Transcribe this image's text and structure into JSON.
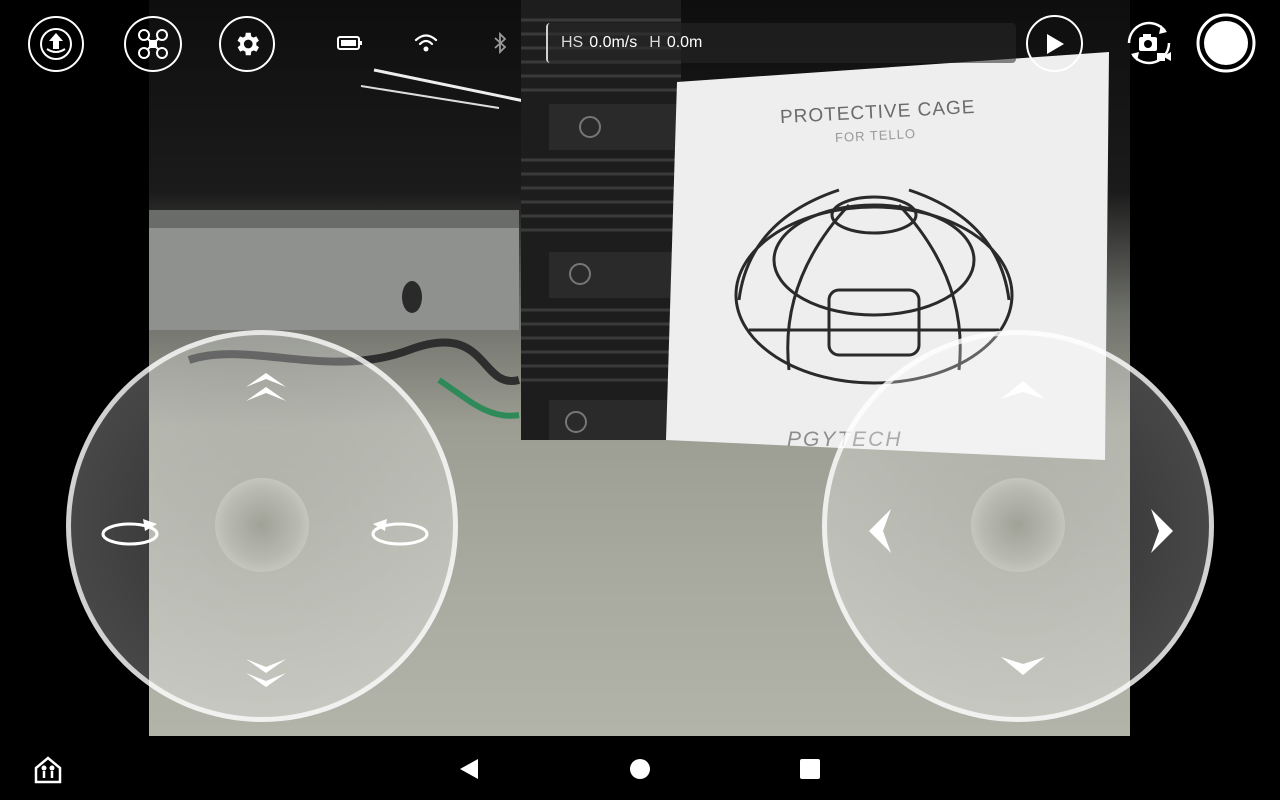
{
  "top_bar": {
    "takeoff_icon": "takeoff-icon",
    "drone_icon": "drone-icon",
    "settings_icon": "gear-icon",
    "status_icons": [
      "battery-icon",
      "wifi-icon",
      "bluetooth-icon"
    ],
    "hs_label": "HS",
    "hs_value": "0.0m/s",
    "h_label": "H",
    "h_value": "0.0m",
    "play_icon": "play-icon",
    "camera_switch_icon": "camera-switch-icon",
    "shutter_icon": "shutter-icon"
  },
  "camera_feed": {
    "sign_title": "PROTECTIVE CAGE",
    "sign_subtitle": "FOR TELLO",
    "sign_brand": "PGYTECH"
  },
  "left_joystick": {
    "up_icon": "double-chevron-up-icon",
    "down_icon": "double-chevron-down-icon",
    "rotate_left_icon": "rotate-ccw-icon",
    "rotate_right_icon": "rotate-cw-icon"
  },
  "right_joystick": {
    "up_icon": "chevron-up-icon",
    "down_icon": "chevron-down-icon",
    "left_icon": "chevron-left-icon",
    "right_icon": "chevron-right-icon"
  },
  "nav_bar": {
    "app_icon": "accessibility-home-icon",
    "back_icon": "back-triangle-icon",
    "home_icon": "home-circle-icon",
    "recents_icon": "recents-square-icon"
  },
  "colors": {
    "overlay": "#ffffff",
    "background": "#000000"
  }
}
